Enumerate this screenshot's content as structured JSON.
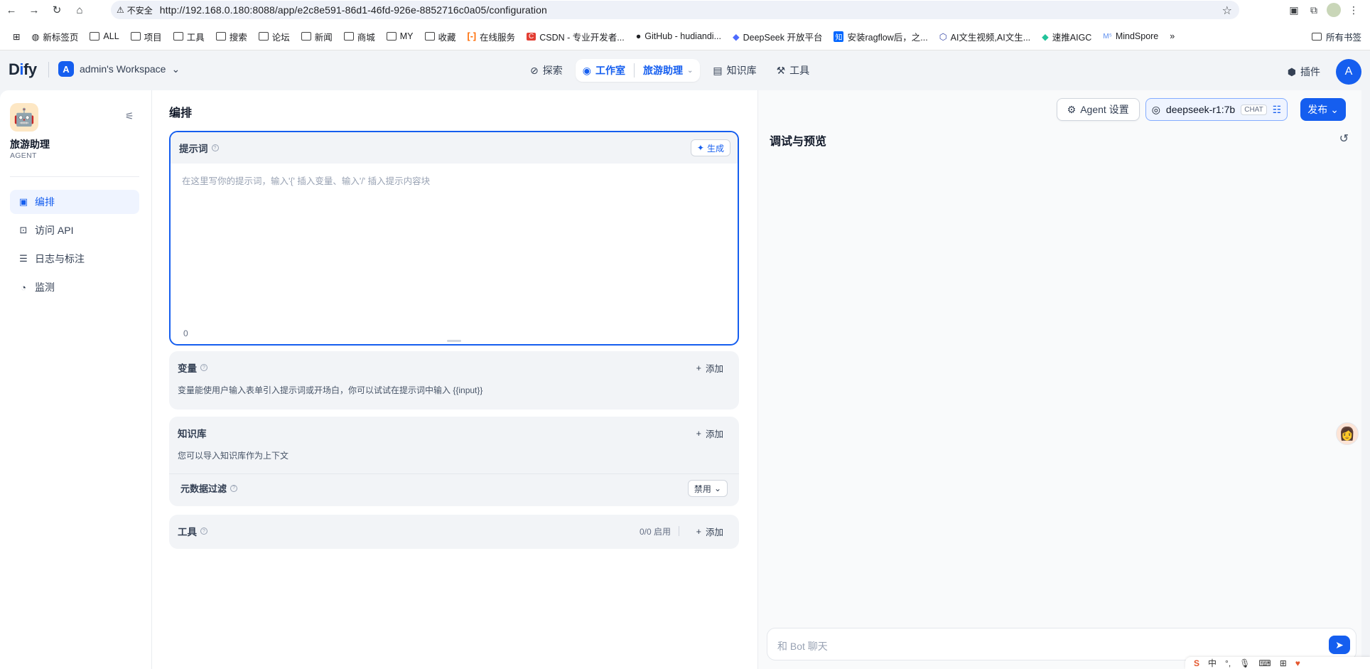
{
  "browser": {
    "insecure_label": "不安全",
    "url": "http://192.168.0.180:8088/app/e2c8e591-86d1-46fd-926e-8852716c0a05/configuration",
    "bookmarks": [
      "新标签页",
      "ALL",
      "项目",
      "工具",
      "搜索",
      "论坛",
      "新闻",
      "商城",
      "MY",
      "收藏",
      "在线服务",
      "CSDN - 专业开发者...",
      "GitHub - hudiandi...",
      "DeepSeek 开放平台",
      "安装ragflow后，之...",
      "AI文生视频,AI文生...",
      "速推AIGC",
      "MindSpore"
    ],
    "more": "»",
    "all_bookmarks": "所有书签"
  },
  "app": {
    "logo_d": "D",
    "logo_i": "i",
    "logo_rest": "fy",
    "workspace_initial": "A",
    "workspace_name": "admin's Workspace",
    "nav": {
      "explore": "探索",
      "studio": "工作室",
      "studio_app": "旅游助理",
      "knowledge": "知识库",
      "tools": "工具"
    },
    "plugins": "插件",
    "user_initial": "A"
  },
  "sidebar": {
    "agent_name": "旅游助理",
    "agent_type": "AGENT",
    "items": [
      {
        "label": "编排",
        "icon": "layout-icon"
      },
      {
        "label": "访问 API",
        "icon": "terminal-icon"
      },
      {
        "label": "日志与标注",
        "icon": "file-list-icon"
      },
      {
        "label": "监测",
        "icon": "dashboard-icon"
      }
    ]
  },
  "main": {
    "title": "编排",
    "prompt": {
      "title": "提示词",
      "generate": "生成",
      "placeholder": "在这里写你的提示词，输入'{' 插入变量、输入'/' 插入提示内容块",
      "char_count": "0"
    },
    "variables": {
      "title": "变量",
      "add": "添加",
      "desc": "变量能使用户输入表单引入提示词或开场白，你可以试试在提示词中输入 {{input}}"
    },
    "knowledge": {
      "title": "知识库",
      "add": "添加",
      "desc": "您可以导入知识库作为上下文",
      "meta_filter": "元数据过滤",
      "meta_value": "禁用"
    },
    "tools": {
      "title": "工具",
      "count": "0/0 启用",
      "add": "添加"
    }
  },
  "header_actions": {
    "agent_settings": "Agent 设置",
    "model": "deepseek-r1:7b",
    "model_tag": "CHAT",
    "publish": "发布"
  },
  "preview": {
    "title": "调试与预览",
    "chat_placeholder": "和 Bot 聊天"
  },
  "ime": {
    "lang": "中"
  }
}
